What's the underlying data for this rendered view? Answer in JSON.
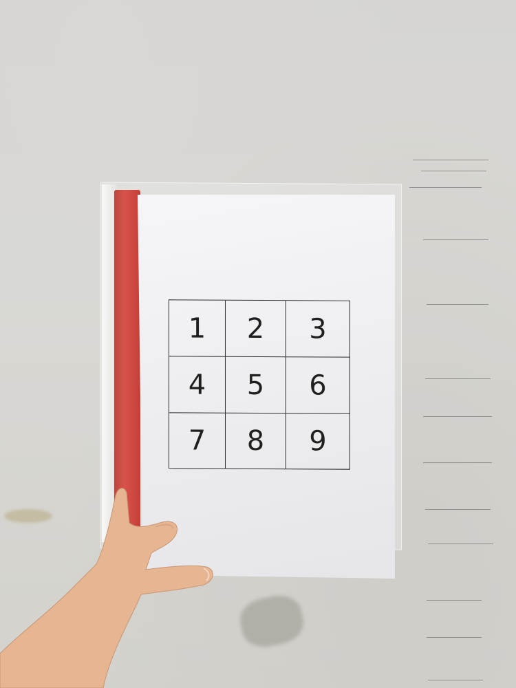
{
  "grid": {
    "cells": [
      "1",
      "2",
      "3",
      "4",
      "5",
      "6",
      "7",
      "8",
      "9"
    ]
  },
  "colors": {
    "wall": "#d6d5d1",
    "paper": "#f2f2f4",
    "spine": "#d9534a",
    "grid_lines": "#2a2a2a",
    "skin": "#e8b995"
  }
}
